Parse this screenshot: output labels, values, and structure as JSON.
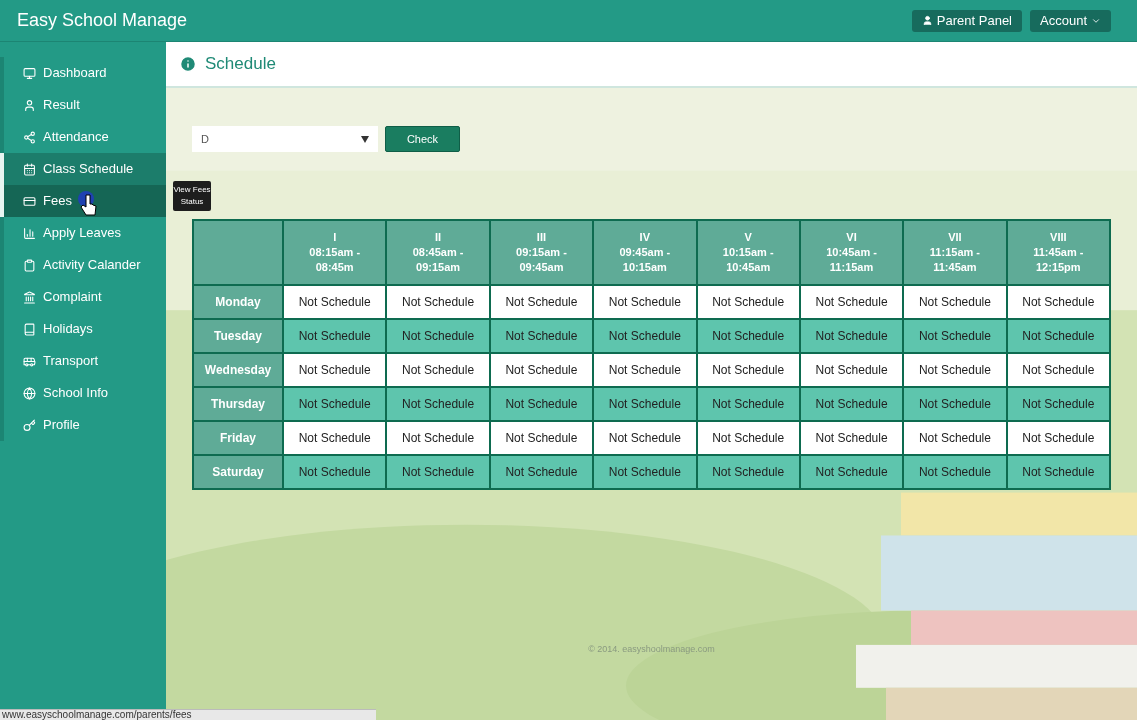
{
  "header": {
    "brand": "Easy School Manage",
    "buttons": [
      {
        "label": "Parent Panel",
        "kind": "user"
      },
      {
        "label": "Account",
        "kind": "dropdown"
      }
    ]
  },
  "sidebar": {
    "items": [
      {
        "label": "Dashboard",
        "selected": false,
        "hovered": false
      },
      {
        "label": "Result",
        "selected": false,
        "hovered": false
      },
      {
        "label": "Attendance",
        "selected": false,
        "hovered": false
      },
      {
        "label": "Class Schedule",
        "selected": true,
        "hovered": false
      },
      {
        "label": "Fees",
        "selected": false,
        "hovered": true
      },
      {
        "label": "Apply Leaves",
        "selected": false,
        "hovered": false
      },
      {
        "label": "Activity Calander",
        "selected": false,
        "hovered": false
      },
      {
        "label": "Complaint",
        "selected": false,
        "hovered": false
      },
      {
        "label": "Holidays",
        "selected": false,
        "hovered": false
      },
      {
        "label": "Transport",
        "selected": false,
        "hovered": false
      },
      {
        "label": "School Info",
        "selected": false,
        "hovered": false
      },
      {
        "label": "Profile",
        "selected": false,
        "hovered": false
      }
    ],
    "tooltip": "View Fees Status"
  },
  "page": {
    "title": "Schedule",
    "select": {
      "value": "D"
    },
    "check_button": "Check"
  },
  "table": {
    "columns": [
      {
        "numeral": "I",
        "time": "08:15am - 08:45m"
      },
      {
        "numeral": "II",
        "time": "08:45am - 09:15am"
      },
      {
        "numeral": "III",
        "time": "09:15am - 09:45am"
      },
      {
        "numeral": "IV",
        "time": "09:45am - 10:15am"
      },
      {
        "numeral": "V",
        "time": "10:15am - 10:45am"
      },
      {
        "numeral": "VI",
        "time": "10:45am - 11:15am"
      },
      {
        "numeral": "VII",
        "time": "11:15am - 11:45am"
      },
      {
        "numeral": "VIII",
        "time": "11:45am - 12:15pm"
      }
    ],
    "rows": [
      {
        "day": "Monday",
        "cells": [
          "Not Schedule",
          "Not Schedule",
          "Not Schedule",
          "Not Schedule",
          "Not Schedule",
          "Not Schedule",
          "Not Schedule",
          "Not Schedule"
        ]
      },
      {
        "day": "Tuesday",
        "cells": [
          "Not Schedule",
          "Not Schedule",
          "Not Schedule",
          "Not Schedule",
          "Not Schedule",
          "Not Schedule",
          "Not Schedule",
          "Not Schedule"
        ]
      },
      {
        "day": "Wednesday",
        "cells": [
          "Not Schedule",
          "Not Schedule",
          "Not Schedule",
          "Not Schedule",
          "Not Schedule",
          "Not Schedule",
          "Not Schedule",
          "Not Schedule"
        ]
      },
      {
        "day": "Thursday",
        "cells": [
          "Not Schedule",
          "Not Schedule",
          "Not Schedule",
          "Not Schedule",
          "Not Schedule",
          "Not Schedule",
          "Not Schedule",
          "Not Schedule"
        ]
      },
      {
        "day": "Friday",
        "cells": [
          "Not Schedule",
          "Not Schedule",
          "Not Schedule",
          "Not Schedule",
          "Not Schedule",
          "Not Schedule",
          "Not Schedule",
          "Not Schedule"
        ]
      },
      {
        "day": "Saturday",
        "cells": [
          "Not Schedule",
          "Not Schedule",
          "Not Schedule",
          "Not Schedule",
          "Not Schedule",
          "Not Schedule",
          "Not Schedule",
          "Not Schedule"
        ]
      }
    ]
  },
  "footer": "© 2014. easyshoolmanage.com",
  "status_bar": "www.easyschoolmanage.com/parents/fees"
}
